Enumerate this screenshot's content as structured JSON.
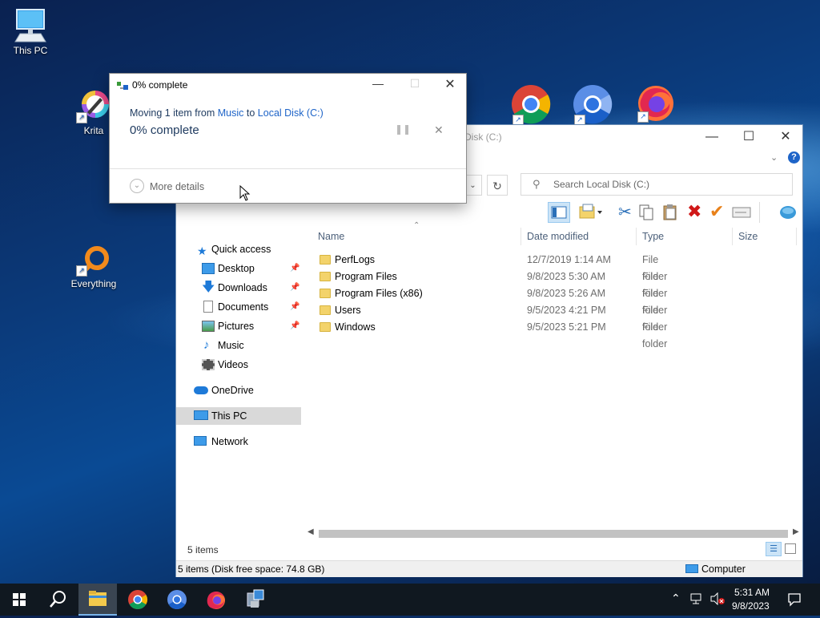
{
  "desktop": {
    "icons": [
      {
        "label": "This PC"
      },
      {
        "label": "Krita"
      },
      {
        "label": "Everything"
      }
    ]
  },
  "dialog": {
    "title": "0% complete",
    "message_prefix": "Moving 1 item from ",
    "source": "Music",
    "connector": " to ",
    "destination": "Local Disk (C:)",
    "progress_text": "0% complete",
    "progress_percent": 0,
    "more_details": "More details"
  },
  "explorer": {
    "title_partial": "Disk (C:)",
    "search_placeholder": "Search Local Disk (C:)",
    "nav": {
      "quick_access": "Quick access",
      "items": [
        {
          "label": "Desktop",
          "pinned": true
        },
        {
          "label": "Downloads",
          "pinned": true
        },
        {
          "label": "Documents",
          "pinned": true
        },
        {
          "label": "Pictures",
          "pinned": true
        },
        {
          "label": "Music",
          "pinned": false
        },
        {
          "label": "Videos",
          "pinned": false
        }
      ],
      "onedrive": "OneDrive",
      "this_pc": "This PC",
      "network": "Network"
    },
    "columns": {
      "name": "Name",
      "date": "Date modified",
      "type": "Type",
      "size": "Size"
    },
    "rows": [
      {
        "name": "PerfLogs",
        "date": "12/7/2019 1:14 AM",
        "type": "File folder"
      },
      {
        "name": "Program Files",
        "date": "9/8/2023 5:30 AM",
        "type": "File folder"
      },
      {
        "name": "Program Files (x86)",
        "date": "9/8/2023 5:26 AM",
        "type": "File folder"
      },
      {
        "name": "Users",
        "date": "9/5/2023 4:21 PM",
        "type": "File folder"
      },
      {
        "name": "Windows",
        "date": "9/5/2023 5:21 PM",
        "type": "File folder"
      }
    ],
    "item_count": "5 items",
    "status_bar": "5 items (Disk free space: 74.8 GB)",
    "status_location": "Computer"
  },
  "taskbar": {
    "time": "5:31 AM",
    "date": "9/8/2023"
  },
  "colors": {
    "accent": "#1e64c8",
    "selected_nav": "#d9d9d9",
    "delete_red": "#d01818",
    "check_orange": "#e8811a"
  }
}
